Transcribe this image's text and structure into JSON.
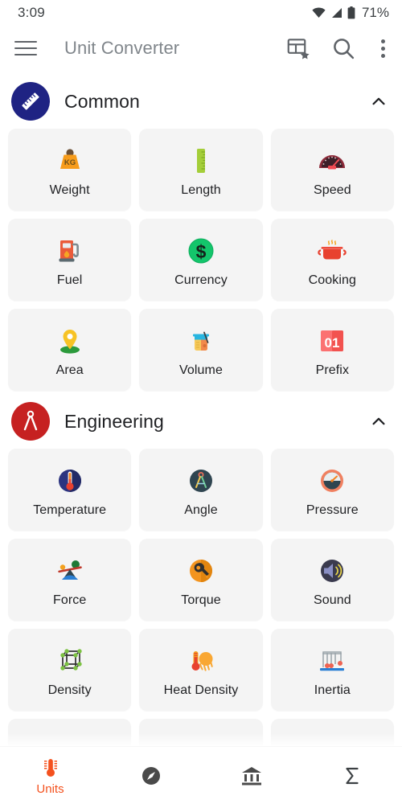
{
  "status_bar": {
    "time": "3:09",
    "battery_percent": "71%",
    "icons": [
      "wifi-icon",
      "signal-icon",
      "battery-icon"
    ]
  },
  "app_bar": {
    "menu_icon": "hamburger-menu-icon",
    "title": "Unit Converter",
    "actions": [
      {
        "name": "favorites-table-icon",
        "label": "Favorites"
      },
      {
        "name": "search-icon",
        "label": "Search"
      },
      {
        "name": "overflow-menu-icon",
        "label": "More options"
      }
    ]
  },
  "sections": [
    {
      "title": "Common",
      "icon": "ruler-icon",
      "circle_color": "#1F2383",
      "expanded": true,
      "chevron": "chevron-up-icon",
      "items": [
        {
          "label": "Weight",
          "icon": "kg-weight-icon"
        },
        {
          "label": "Length",
          "icon": "ruler-green-icon"
        },
        {
          "label": "Speed",
          "icon": "speedometer-icon"
        },
        {
          "label": "Fuel",
          "icon": "fuel-pump-icon"
        },
        {
          "label": "Currency",
          "icon": "dollar-coin-icon"
        },
        {
          "label": "Cooking",
          "icon": "cooking-pot-icon"
        },
        {
          "label": "Area",
          "icon": "map-pin-icon"
        },
        {
          "label": "Volume",
          "icon": "beaker-icon"
        },
        {
          "label": "Prefix",
          "icon": "zero-one-icon"
        }
      ]
    },
    {
      "title": "Engineering",
      "icon": "drafting-compass-icon",
      "circle_color": "#C62121",
      "expanded": true,
      "chevron": "chevron-up-icon",
      "items": [
        {
          "label": "Temperature",
          "icon": "thermometer-icon"
        },
        {
          "label": "Angle",
          "icon": "compass-angle-icon"
        },
        {
          "label": "Pressure",
          "icon": "pressure-gauge-icon"
        },
        {
          "label": "Force",
          "icon": "seesaw-force-icon"
        },
        {
          "label": "Torque",
          "icon": "wrench-torque-icon"
        },
        {
          "label": "Sound",
          "icon": "speaker-sound-icon"
        },
        {
          "label": "Density",
          "icon": "lattice-cube-icon"
        },
        {
          "label": "Heat Density",
          "icon": "heat-thermometer-icon"
        },
        {
          "label": "Inertia",
          "icon": "newtons-cradle-icon"
        }
      ]
    }
  ],
  "bottom_nav": {
    "active_color": "#F4511E",
    "items": [
      {
        "label": "Units",
        "icon": "thermometer-units-icon",
        "active": true
      },
      {
        "label": "",
        "icon": "compass-icon",
        "active": false
      },
      {
        "label": "",
        "icon": "bank-icon",
        "active": false
      },
      {
        "label": "",
        "icon": "sigma-icon",
        "active": false
      }
    ]
  }
}
